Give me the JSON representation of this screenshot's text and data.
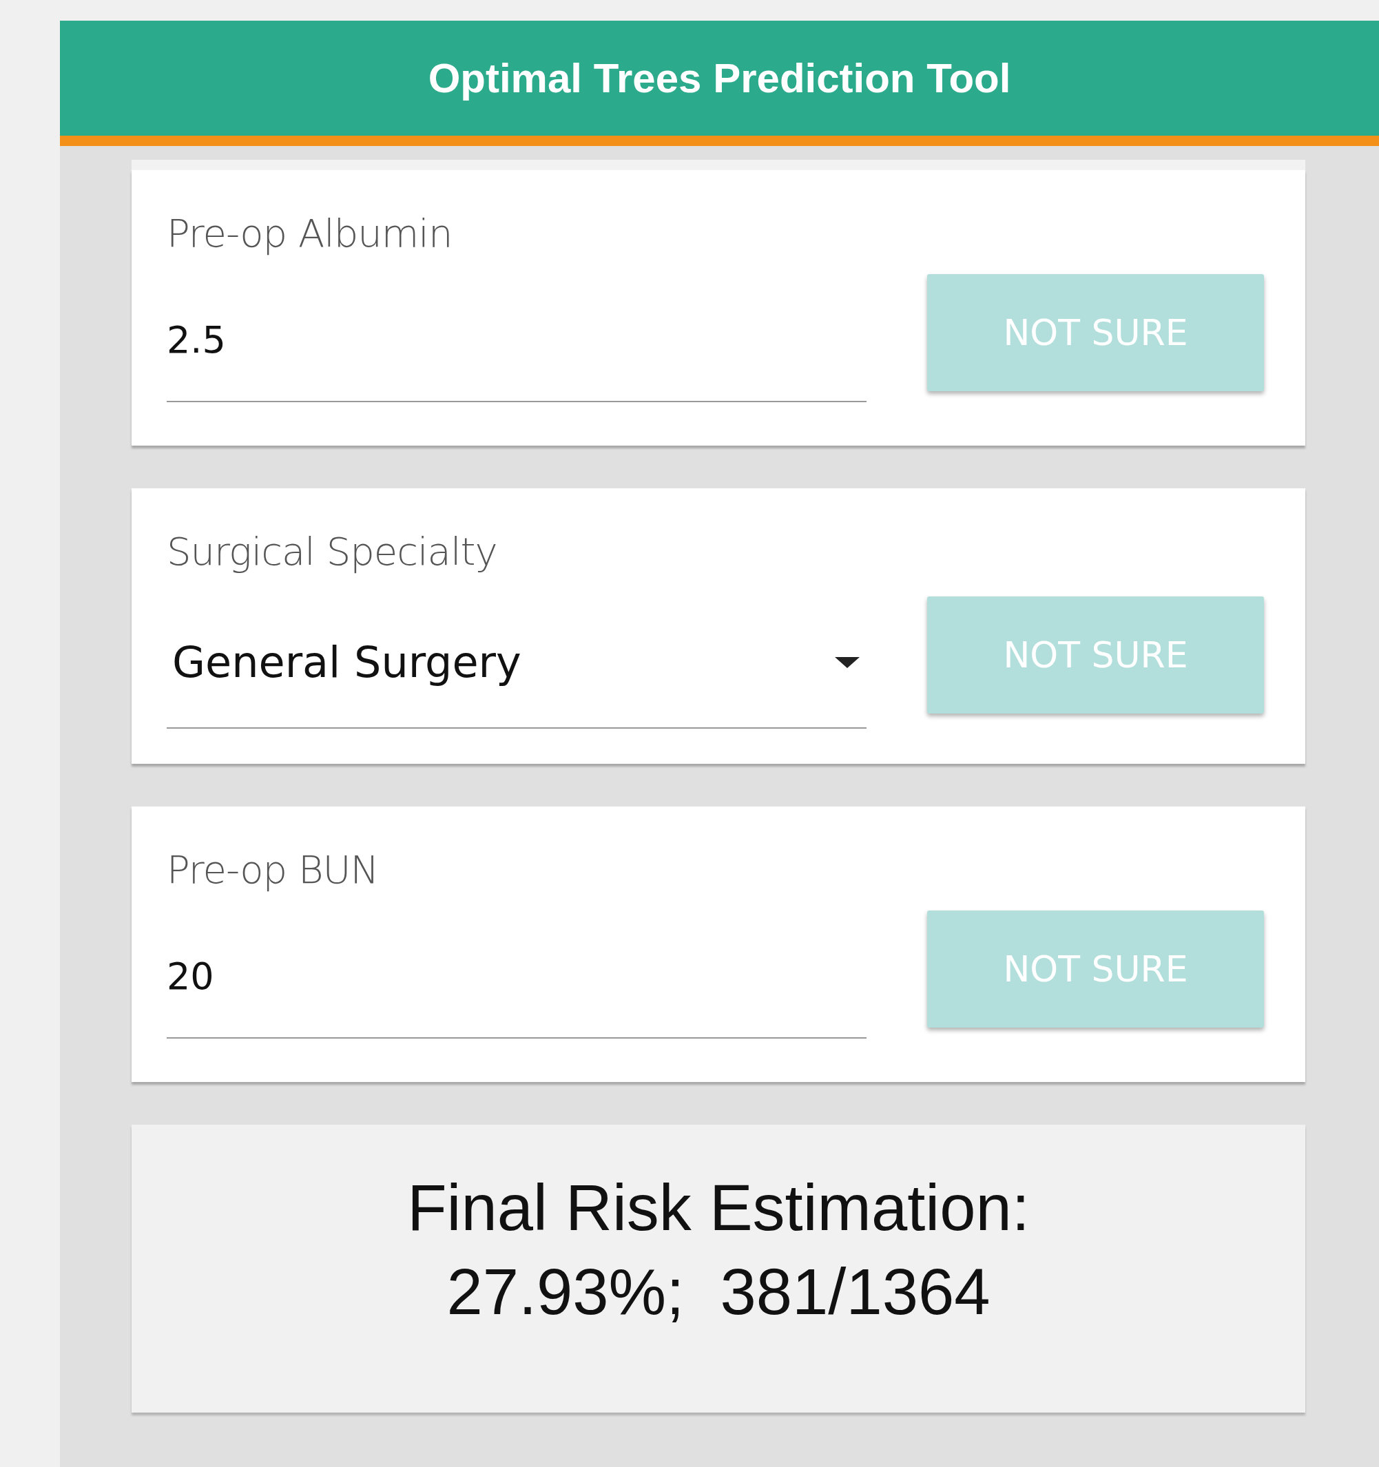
{
  "header": {
    "title": "Optimal Trees Prediction Tool"
  },
  "fields": [
    {
      "kind": "input",
      "label": "Pre-op Albumin",
      "value": "2.5",
      "button": "NOT SURE"
    },
    {
      "kind": "select",
      "label": "Surgical Specialty",
      "value": "General Surgery",
      "button": "NOT SURE"
    },
    {
      "kind": "input",
      "label": "Pre-op BUN",
      "value": "20",
      "button": "NOT SURE"
    }
  ],
  "result": {
    "lines": [
      "Final Risk Estimation:",
      "27.93%;  381/1364"
    ]
  }
}
